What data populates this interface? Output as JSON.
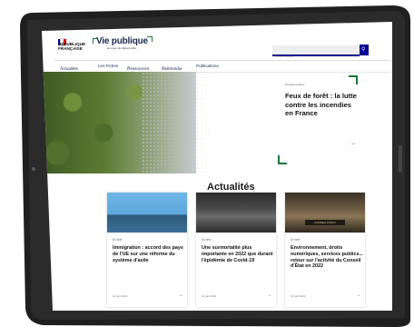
{
  "header": {
    "gov_line1": "RÉPUBLIQUE",
    "gov_line2": "FRANÇAISE",
    "brand": "Vie publique",
    "tagline": "au cœur du débat public",
    "search_placeholder": "Rechercher"
  },
  "nav": {
    "items": [
      "Actualités",
      "Les Fiches",
      "Ressources",
      "Multimédia",
      "Publications"
    ]
  },
  "hero": {
    "category": "Dossiers légaux",
    "title": "Feux de forêt : la lutte contre les incendies en France"
  },
  "actualites": {
    "title": "Actualités",
    "cards": [
      {
        "category": "En bref",
        "title": "Immigration : accord des pays de l'UE sur une réforme du système d'asile",
        "date": "14 juin 2022"
      },
      {
        "category": "En bref",
        "title": "Une surmortalité plus importante en 2022 que durant l'épidémie de Covid-19",
        "date": "14 juin 2022"
      },
      {
        "category": "En bref",
        "title": "Environnement, droits numériques, services publics... retour sur l'activité du Conseil d'État en 2022",
        "date": "14 juin 2022"
      }
    ]
  },
  "colors": {
    "primary_blue": "#000091",
    "accent_green": "#18753c"
  }
}
